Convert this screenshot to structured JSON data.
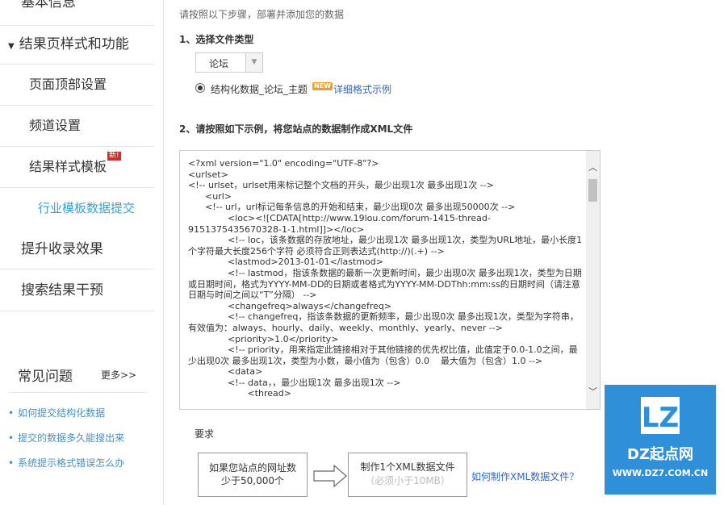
{
  "sidebar": {
    "top_item": "基本信息",
    "section_label": "结果页样式和功能",
    "sub_items": [
      {
        "label": "页面顶部设置"
      },
      {
        "label": "频道设置"
      },
      {
        "label": "结果样式模板",
        "badge": "新!"
      }
    ],
    "active_item": "行业模板数据提交",
    "items_after": [
      {
        "label": "提升收录效果"
      },
      {
        "label": "搜索结果干预"
      }
    ],
    "faq_title": "常见问题",
    "faq_more": "更多>>",
    "faq_links": [
      {
        "label": "如何提交结构化数据"
      },
      {
        "label": "提交的数据多久能搜出来"
      },
      {
        "label": "系统提示格式错误怎么办"
      }
    ]
  },
  "main": {
    "intro": "请按照以下步骤，部署并添加您的数据",
    "step1_title": "1、选择文件类型",
    "file_type_value": "论坛",
    "radio_label": "结构化数据_论坛_主题",
    "new_tag": "NEW",
    "example_link": "详细格式示例",
    "step2_title": "2、请按照如下示例，将您站点的数据制作成XML文件",
    "xml_lines": [
      "<?xml version=\"1.0\" encoding=\"UTF-8\"?>",
      "<urlset>",
      "<!-- urlset，urlset用来标记整个文档的开头，最少出现1次 最多出现1次 -->",
      "      <url>",
      "      <!-- url，url标记每条信息的开始和结束，最少出现0次 最多出现50000次 -->",
      "              <loc><![CDATA[http://www.19lou.com/forum-1415-thread-9151375435670328-1-1.html]]></loc>",
      "              <!-- loc，该条数据的存放地址，最少出现1次 最多出现1次，类型为URL地址，最小长度1个字符最大长度256个字符 必须符合正则表达式(http://)(.+) -->",
      "              <lastmod>2013-01-01</lastmod>",
      "              <!-- lastmod，指该条数据的最新一次更新时间，最少出现0次 最多出现1次，类型为日期或日期时间，格式为YYYY-MM-DD的日期或者格式为YYYY-MM-DDThh:mm:ss的日期时间（请注意日期与时间之间以“T”分隔） -->",
      "              <changefreq>always</changefreq>",
      "              <!-- changefreq，指该条数据的更新频率，最少出现0次 最多出现1次，类型为字符串，有效值为：always、hourly、daily、weekly、monthly、yearly、never -->",
      "              <priority>1.0</priority>",
      "              <!-- priority，用来指定此链接相对于其他链接的优先权比值，此值定于0.0-1.0之间，最少出现0次 最多出现1次，类型为小数，最小值为（包含）0.0    最大值为（包含）1.0 -->",
      "              <data>",
      "              <!-- data，，最少出现1次 最多出现1次 -->",
      "                     <thread>"
    ],
    "requirement_label": "要求",
    "box1_text": "如果您站点的网址数少于50,000个",
    "box2_title": "制作1个XML数据文件",
    "box2_note": "（必须小于10MB）",
    "howto_link": "如何制作XML数据文件？"
  },
  "watermark": {
    "logo_text": "LZ",
    "brand": "DZ起点网",
    "url": "WWW.DZ7.COM.CN"
  },
  "colors": {
    "accent_blue": "#3aa0d8",
    "link_blue": "#3366cc",
    "badge_red": "#c9302c",
    "new_orange": "#f0a020",
    "watermark_blue": "#2f8fd8"
  }
}
